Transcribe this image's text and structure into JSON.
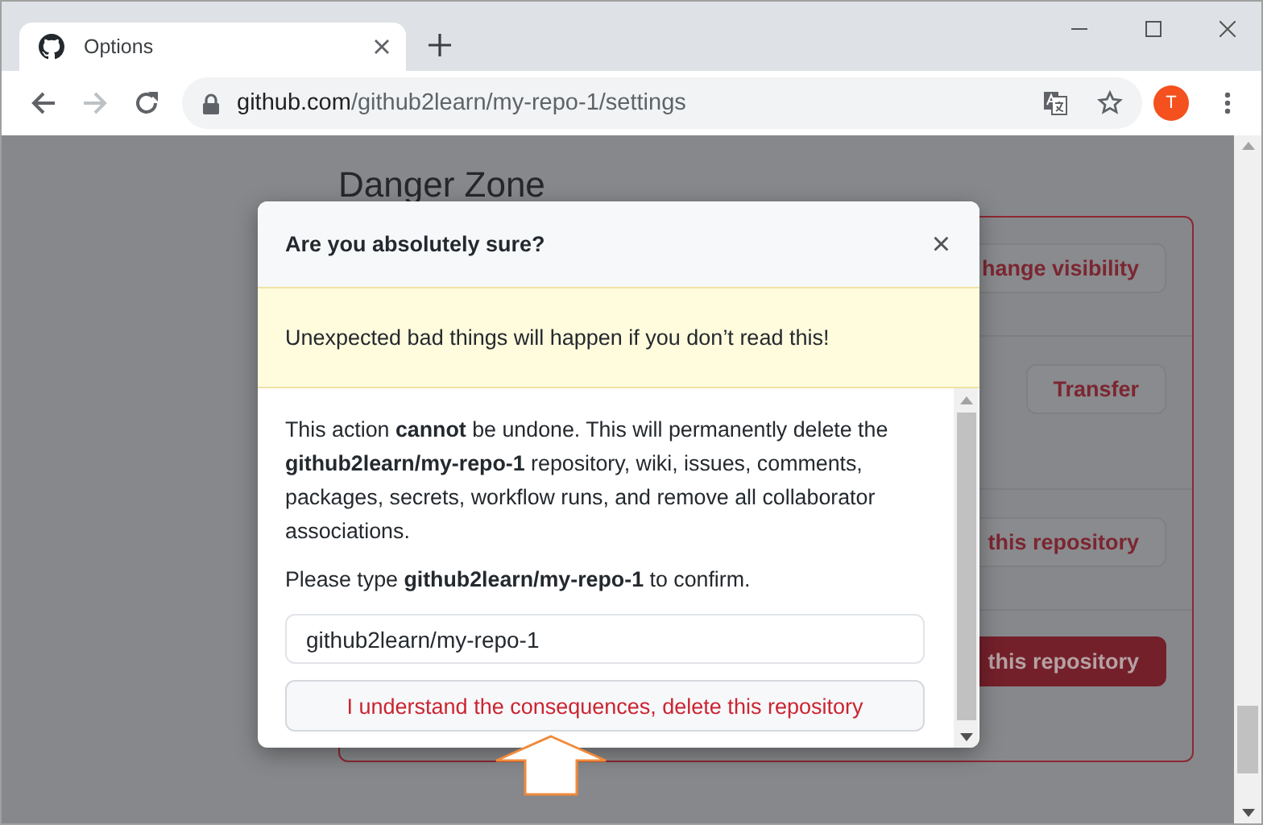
{
  "tabs": [
    {
      "title": "Options",
      "selected": true
    }
  ],
  "toolbar": {
    "nav": [
      {
        "kind": "back",
        "disabled": false
      },
      {
        "kind": "forward",
        "disabled": true
      },
      {
        "kind": "reload",
        "disabled": false
      }
    ],
    "url_host": "github.com",
    "url_path": "/github2learn/my-repo-1/settings",
    "avatar": "T"
  },
  "page": {
    "heading": "Danger Zone",
    "rows": [
      {
        "button": "hange visibility",
        "kind": "outline"
      },
      {
        "button": "Transfer",
        "kind": "outline"
      },
      {
        "button": "this repository",
        "kind": "outline"
      },
      {
        "button": "this repository",
        "kind": "danger"
      }
    ]
  },
  "dialog": {
    "title": "Are you absolutely sure?",
    "close": "×",
    "warning": "Unexpected bad things will happen if you don’t read this!",
    "body": "This action **cannot** be undone. This will permanently delete the **github2learn/my-repo-1** repository, wiki, issues, comments, packages, secrets, workflow runs, and remove all collaborator associations.",
    "prompt": "Please type **github2learn/my-repo-1** to confirm.",
    "input_value": "github2learn/my-repo-1",
    "confirm_button": "I understand the consequences, delete this repository"
  }
}
